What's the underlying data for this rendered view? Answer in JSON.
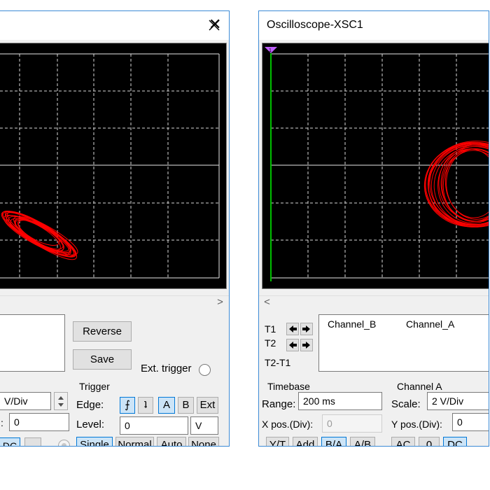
{
  "left_window": {
    "close_glyph": "✕",
    "reverse_label": "Reverse",
    "save_label": "Save",
    "ext_trigger_label": "Ext. trigger",
    "channel": {
      "scale_value": "V/Div",
      "ypos_label": ":",
      "ypos_value": "0",
      "dc_label": "DC",
      "minus_label": "-"
    },
    "trigger": {
      "group_label": "Trigger",
      "edge_label": "Edge:",
      "edge_rise_glyph": "⨍",
      "edge_fall_glyph": "ʇ",
      "a_label": "A",
      "b_label": "B",
      "ext_label": "Ext",
      "level_label": "Level:",
      "level_value": "0",
      "level_unit": "V",
      "single_label": "Single",
      "normal_label": "Normal",
      "auto_label": "Auto",
      "none_label": "None"
    },
    "scroll_right_glyph": ">"
  },
  "right_window": {
    "title": "Oscilloscope-XSC1",
    "t1_label": "T1",
    "t2_label": "T2",
    "t2t1_label": "T2-T1",
    "channel_b_header": "Channel_B",
    "channel_a_header": "Channel_A",
    "timebase": {
      "group_label": "Timebase",
      "range_label": "Range:",
      "range_value": "200 ms",
      "xpos_label": "X pos.(Div):",
      "xpos_value": "0",
      "yt_label": "Y/T",
      "add_label": "Add",
      "ba_label": "B/A",
      "ab_label": "A/B"
    },
    "channel_a": {
      "group_label": "Channel A",
      "scale_label": "Scale:",
      "scale_value": "2  V/Div",
      "ypos_label": "Y pos.(Div):",
      "ypos_value": "0",
      "ac_label": "AC",
      "zero_label": "0",
      "dc_label": "DC"
    },
    "scroll_left_glyph": "<"
  },
  "colors": {
    "trace": "#ff0000",
    "grid": "#ffffff",
    "cursor": "#00c000",
    "cursor_marker": "#c060ff",
    "selected_button": "#cce4f7",
    "window_border": "#3c8bd6"
  }
}
